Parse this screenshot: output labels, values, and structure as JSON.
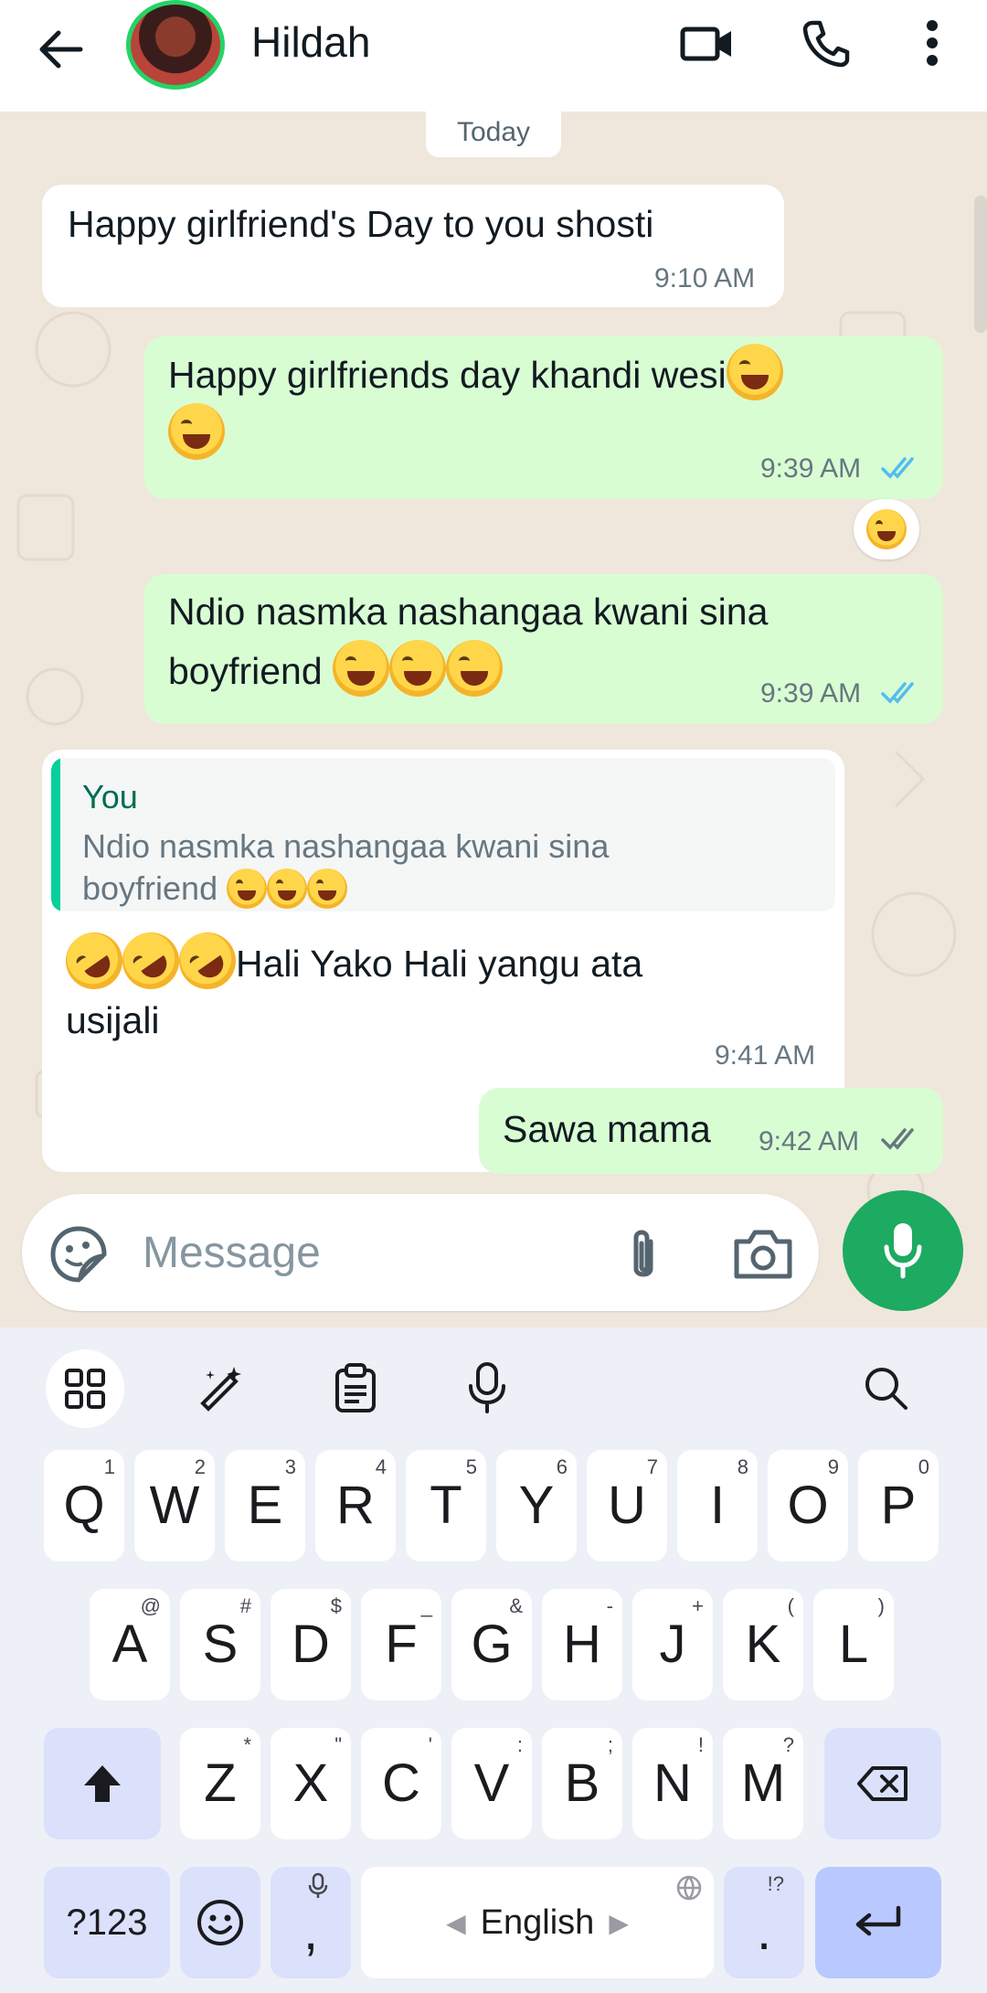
{
  "header": {
    "contact_name": "Hildah",
    "icons": [
      "back-arrow-icon",
      "avatar",
      "video-call-icon",
      "voice-call-icon",
      "more-vert-icon"
    ]
  },
  "chat": {
    "date_label": "Today",
    "messages": [
      {
        "direction": "in",
        "text": "Happy girlfriend's Day to you shosti",
        "time": "9:10 AM"
      },
      {
        "direction": "out",
        "text": "Happy girlfriends day khandi wesi",
        "emoji_tail": "😂😂",
        "time": "9:39 AM",
        "status": "read"
      },
      {
        "direction": "out",
        "reaction": "😂"
      },
      {
        "direction": "out",
        "text_line1": "Ndio nasmka nashangaa kwani sina",
        "text_line2": "boyfriend",
        "emoji_tail": "😂😂😂",
        "time": "9:39 AM",
        "status": "read"
      },
      {
        "direction": "in",
        "quote_author": "You",
        "quote_line1": "Ndio nasmka nashangaa kwani sina",
        "quote_line2": "boyfriend",
        "quote_emoji": "😂😂😂",
        "emoji_head": "🤣🤣🤣",
        "text_line1": "Hali Yako Hali yangu ata",
        "text_line2": "usijali",
        "time": "9:41 AM"
      },
      {
        "direction": "out",
        "text": "Sawa mama",
        "time": "9:42 AM",
        "status": "delivered"
      }
    ]
  },
  "composer": {
    "placeholder": "Message"
  },
  "keyboard": {
    "row1": [
      {
        "k": "Q",
        "h": "1"
      },
      {
        "k": "W",
        "h": "2"
      },
      {
        "k": "E",
        "h": "3"
      },
      {
        "k": "R",
        "h": "4"
      },
      {
        "k": "T",
        "h": "5"
      },
      {
        "k": "Y",
        "h": "6"
      },
      {
        "k": "U",
        "h": "7"
      },
      {
        "k": "I",
        "h": "8"
      },
      {
        "k": "O",
        "h": "9"
      },
      {
        "k": "P",
        "h": "0"
      }
    ],
    "row2": [
      {
        "k": "A",
        "h": "@"
      },
      {
        "k": "S",
        "h": "#"
      },
      {
        "k": "D",
        "h": "$"
      },
      {
        "k": "F",
        "h": "_"
      },
      {
        "k": "G",
        "h": "&"
      },
      {
        "k": "H",
        "h": "-"
      },
      {
        "k": "J",
        "h": "+"
      },
      {
        "k": "K",
        "h": "("
      },
      {
        "k": "L",
        "h": ")"
      }
    ],
    "row3": [
      {
        "k": "Z",
        "h": "*"
      },
      {
        "k": "X",
        "h": "\""
      },
      {
        "k": "C",
        "h": "'"
      },
      {
        "k": "V",
        "h": ":"
      },
      {
        "k": "B",
        "h": ";"
      },
      {
        "k": "N",
        "h": "!"
      },
      {
        "k": "M",
        "h": "?"
      }
    ],
    "symbols_label": "?123",
    "comma_label": ",",
    "period_label": ".",
    "period_hint": "!?",
    "space_label": "English"
  },
  "colors": {
    "accent_green": "#1daa61",
    "outgoing_bubble": "#d9fdd3",
    "read_ticks": "#53bdeb"
  }
}
